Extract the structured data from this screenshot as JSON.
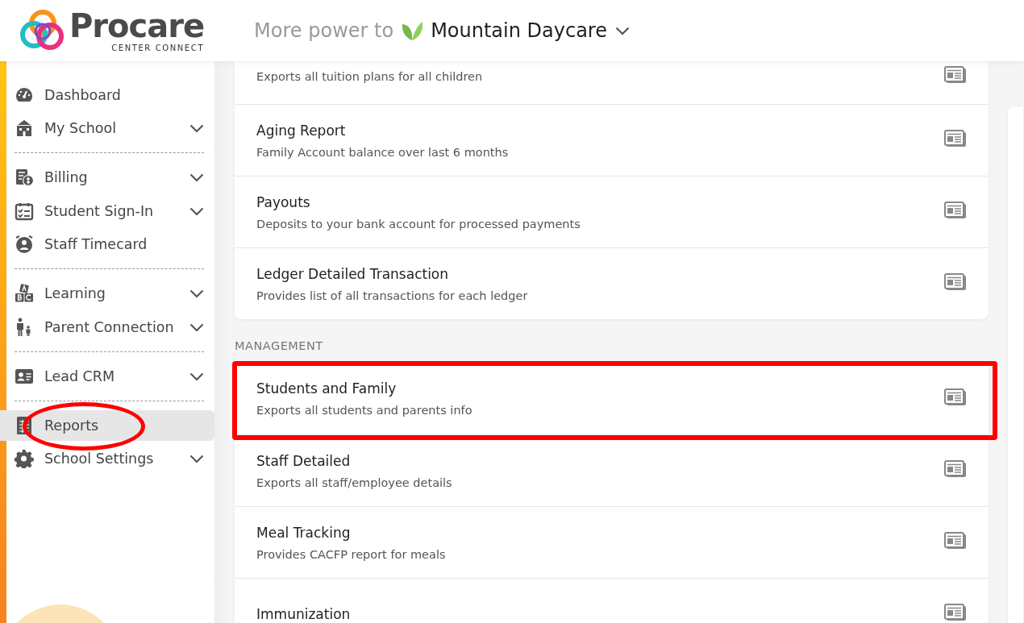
{
  "header": {
    "brand": "Procare",
    "brand_sub": "CENTER CONNECT",
    "tagline": "More power to",
    "school": "Mountain Daycare"
  },
  "sidebar": {
    "sections": [
      {
        "items": [
          {
            "label": "Dashboard",
            "expandable": false,
            "selected": false,
            "circled": false
          },
          {
            "label": "My School",
            "expandable": true,
            "selected": false,
            "circled": false
          }
        ]
      },
      {
        "items": [
          {
            "label": "Billing",
            "expandable": true,
            "selected": false,
            "circled": false
          },
          {
            "label": "Student Sign-In",
            "expandable": true,
            "selected": false,
            "circled": false
          },
          {
            "label": "Staff Timecard",
            "expandable": false,
            "selected": false,
            "circled": false
          }
        ]
      },
      {
        "items": [
          {
            "label": "Learning",
            "expandable": true,
            "selected": false,
            "circled": false
          },
          {
            "label": "Parent Connection",
            "expandable": true,
            "selected": false,
            "circled": false
          }
        ]
      },
      {
        "items": [
          {
            "label": "Lead CRM",
            "expandable": true,
            "selected": false,
            "circled": false
          }
        ]
      },
      {
        "items": [
          {
            "label": "Reports",
            "expandable": false,
            "selected": true,
            "circled": true
          },
          {
            "label": "School Settings",
            "expandable": true,
            "selected": false,
            "circled": false
          }
        ]
      }
    ]
  },
  "report_groups": [
    {
      "reports": [
        {
          "description": "Exports all tuition plans for all children",
          "highlighted": false
        },
        {
          "title": "Aging Report",
          "description": "Family Account balance over last 6 months",
          "highlighted": false
        },
        {
          "title": "Payouts",
          "description": "Deposits to your bank account for processed payments",
          "highlighted": false
        },
        {
          "title": "Ledger Detailed Transaction",
          "description": "Provides list of all transactions for each ledger",
          "highlighted": false
        }
      ]
    },
    {
      "heading": "MANAGEMENT",
      "reports": [
        {
          "title": "Students and Family",
          "description": "Exports all students and parents info",
          "highlighted": true
        },
        {
          "title": "Staff Detailed",
          "description": "Exports all staff/employee details",
          "highlighted": false
        },
        {
          "title": "Meal Tracking",
          "description": "Provides CACFP report for meals",
          "highlighted": false
        },
        {
          "title": "Immunization",
          "highlighted": false
        }
      ]
    }
  ]
}
